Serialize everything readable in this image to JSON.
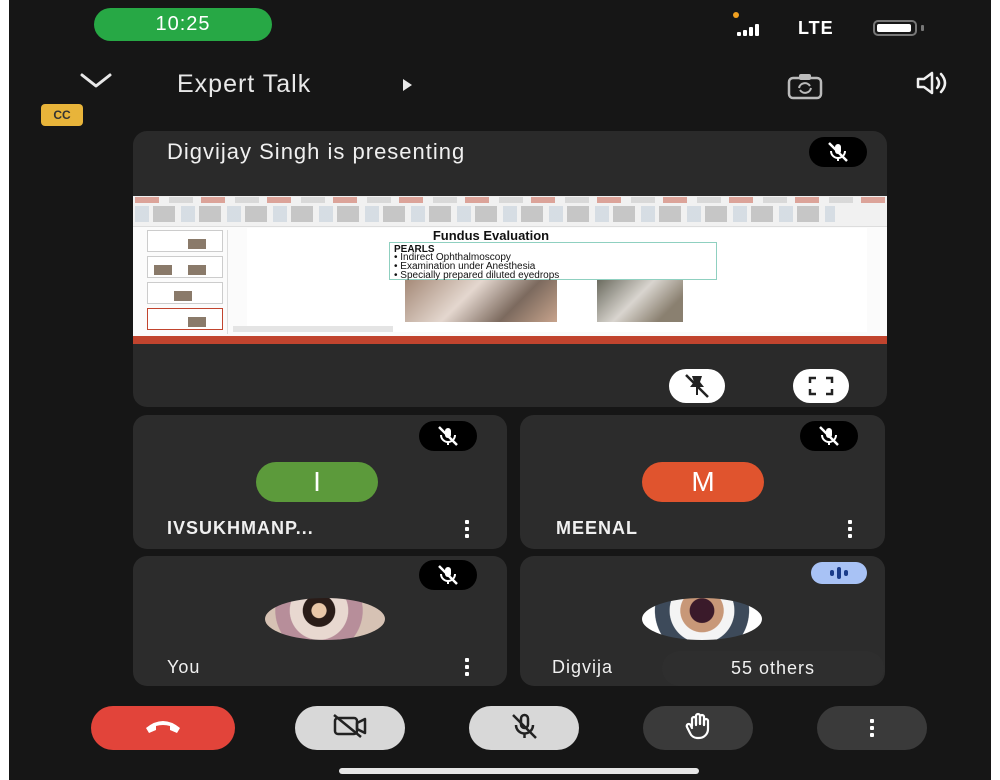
{
  "status_bar": {
    "time": "10:25",
    "network": "LTE",
    "signal_icon": "cell-signal-icon",
    "battery_icon": "battery-icon"
  },
  "header": {
    "title": "Expert Talk",
    "collapse_icon": "chevron-down-icon",
    "flip_camera_icon": "flip-camera-icon",
    "audio_output_icon": "speaker-icon",
    "captions_badge": "CC"
  },
  "presentation": {
    "label": "Digvijay Singh is presenting",
    "mic_icon": "mic-off-icon",
    "slide": {
      "title": "Fundus Evaluation",
      "section": "PEARLS",
      "bullets": [
        "Indirect Ophthalmoscopy",
        "Examination under Anesthesia",
        "Specially prepared diluted eyedrops"
      ]
    },
    "unpin_icon": "unpin-icon",
    "fullscreen_icon": "fullscreen-icon"
  },
  "participants": [
    {
      "name": "IVSUKHMANP...",
      "initial": "I",
      "avatar_color": "#5c9a3b",
      "mic_icon": "mic-off-icon"
    },
    {
      "name": "MEENAL",
      "initial": "M",
      "avatar_color": "#e0542e",
      "mic_icon": "mic-off-icon"
    },
    {
      "name": "You",
      "mic_icon": "mic-off-icon"
    },
    {
      "name": "Digvija",
      "speaking_icon": "speaking-indicator-icon"
    }
  ],
  "others_label": "55 others",
  "controls": {
    "end_call": {
      "icon": "phone-hangup-icon",
      "color": "#e2443a"
    },
    "camera": {
      "icon": "camera-off-icon"
    },
    "mic": {
      "icon": "mic-off-icon"
    },
    "raise_hand": {
      "icon": "hand-icon"
    },
    "more": {
      "icon": "more-vert-icon"
    }
  }
}
